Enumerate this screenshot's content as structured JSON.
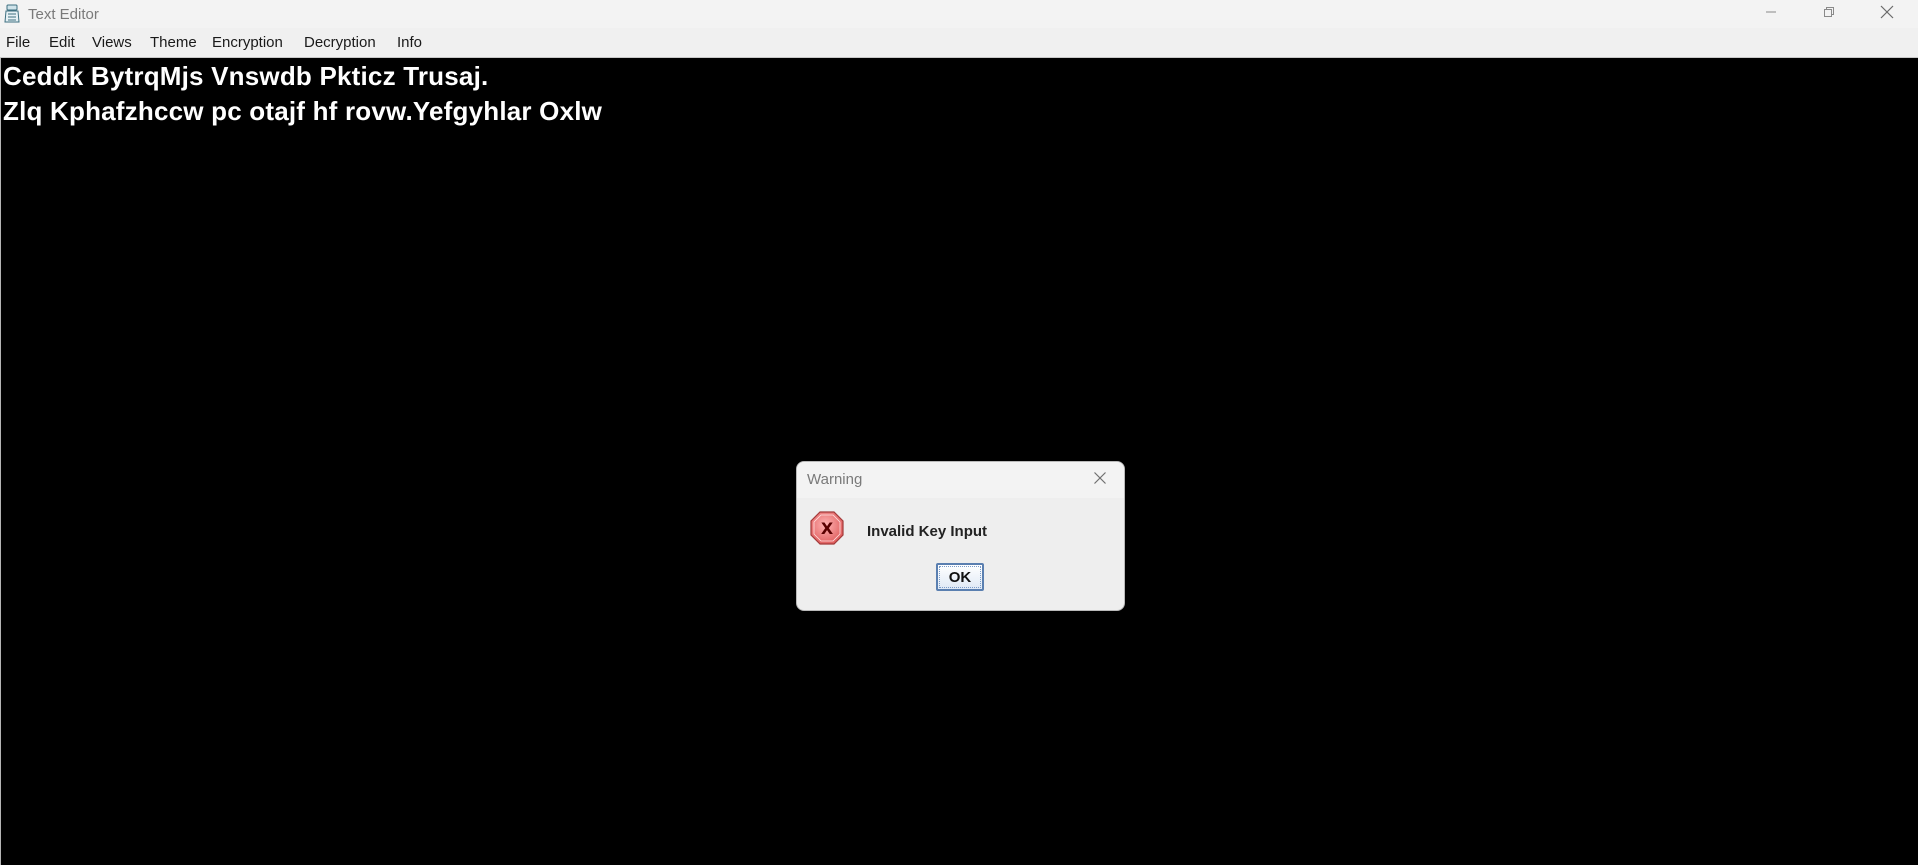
{
  "window": {
    "title": "Text Editor",
    "icon": "inkwell-app-icon",
    "controls": [
      "minimize-icon",
      "restore-icon",
      "close-icon"
    ]
  },
  "menu": {
    "items": [
      {
        "label": "File"
      },
      {
        "label": "Edit"
      },
      {
        "label": "Views"
      },
      {
        "label": "Theme"
      },
      {
        "label": "Encryption"
      },
      {
        "label": "Decryption"
      },
      {
        "label": "Info"
      }
    ]
  },
  "editor": {
    "lines": [
      "Ceddk BytrqMjs Vnswdb Pkticz Trusaj.",
      "Zlq Kphafzhccw pc otajf hf rovw.Yefgyhlar Oxlw"
    ],
    "background": "#000000",
    "text_color": "#ffffff"
  },
  "dialog": {
    "title": "Warning",
    "message": "Invalid Key Input",
    "icon": "error-x-icon",
    "ok_label": "OK"
  }
}
